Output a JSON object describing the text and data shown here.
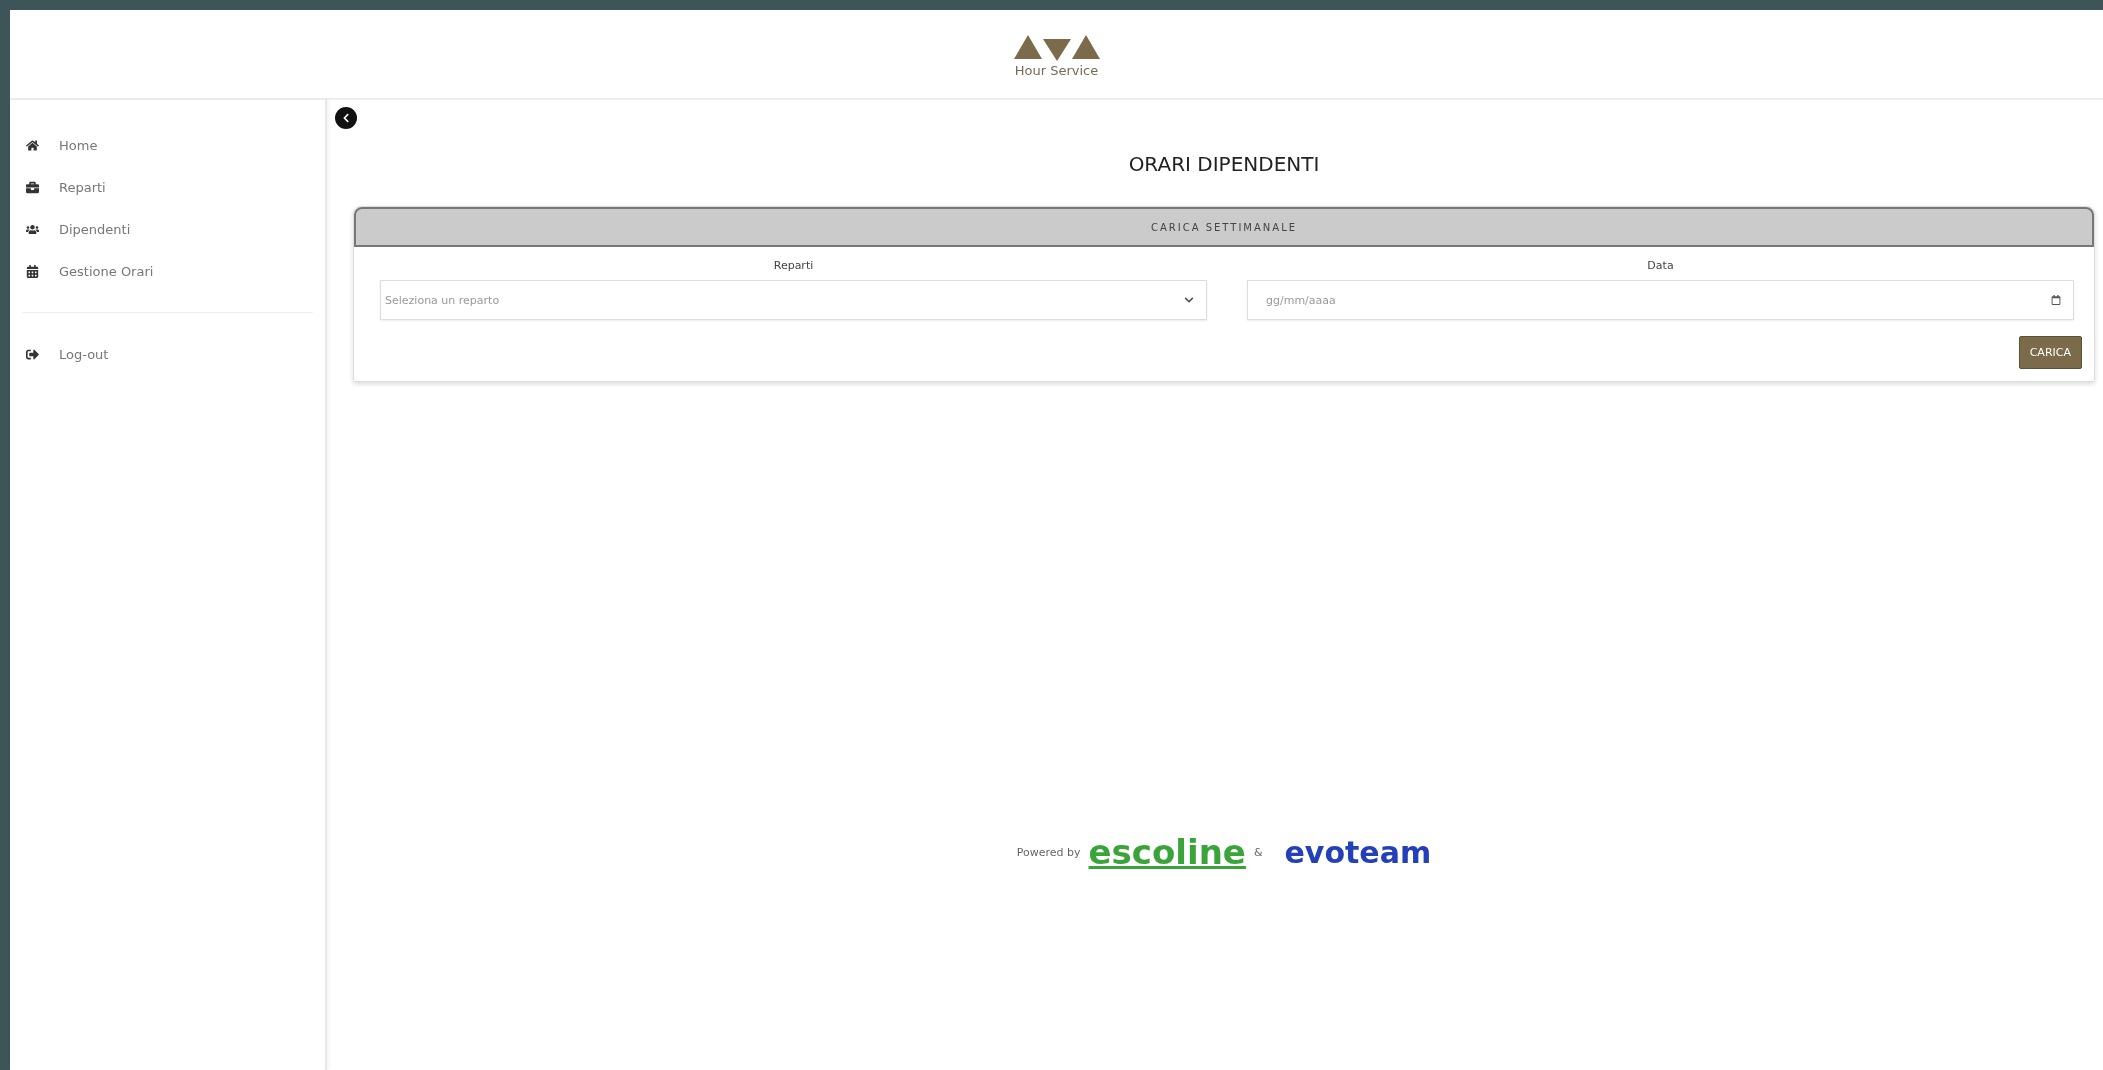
{
  "header": {
    "brand": "Hour Service"
  },
  "sidebar": {
    "items": [
      {
        "label": "Home"
      },
      {
        "label": "Reparti"
      },
      {
        "label": "Dipendenti"
      },
      {
        "label": "Gestione Orari"
      }
    ],
    "logout": {
      "label": "Log-out"
    }
  },
  "page_title": "ORARI DIPENDENTI",
  "card": {
    "title": "CARICA SETTIMANALE",
    "fields": [
      {
        "kind": "select",
        "label": "Reparti",
        "placeholder": "Seleziona un reparto"
      },
      {
        "kind": "date",
        "label": "Data",
        "placeholder": "gg/mm/aaaa"
      }
    ],
    "button": "CARICA"
  },
  "footer": {
    "powered": "Powered by",
    "logo_1": "escoline",
    "separator": "&",
    "logo_2": "evoteam"
  }
}
